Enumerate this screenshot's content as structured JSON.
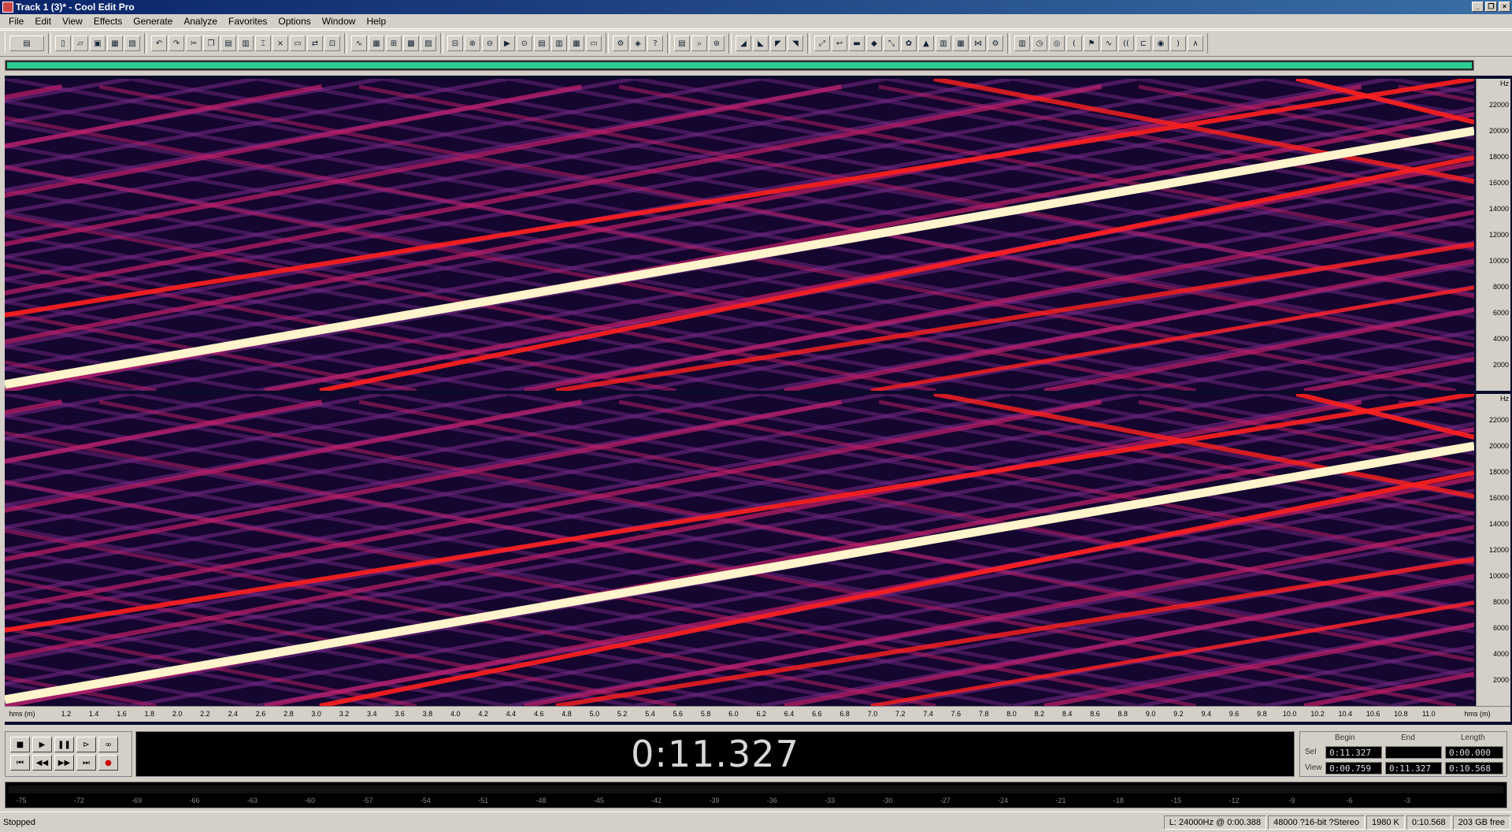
{
  "window": {
    "title": "Track 1 (3)* - Cool Edit Pro"
  },
  "menu": [
    "File",
    "Edit",
    "View",
    "Effects",
    "Generate",
    "Analyze",
    "Favorites",
    "Options",
    "Window",
    "Help"
  ],
  "spectral": {
    "freq_ticks": [
      "22000",
      "20000",
      "18000",
      "16000",
      "14000",
      "12000",
      "10000",
      "8000",
      "6000",
      "4000",
      "2000"
    ],
    "freq_unit": "Hz",
    "time_unit": "hms (m)",
    "time_ticks": [
      "1.2",
      "1.4",
      "1.6",
      "1.8",
      "2.0",
      "2.2",
      "2.4",
      "2.6",
      "2.8",
      "3.0",
      "3.2",
      "3.4",
      "3.6",
      "3.8",
      "4.0",
      "4.2",
      "4.4",
      "4.6",
      "4.8",
      "5.0",
      "5.2",
      "5.4",
      "5.6",
      "5.8",
      "6.0",
      "6.2",
      "6.4",
      "6.6",
      "6.8",
      "7.0",
      "7.2",
      "7.4",
      "7.6",
      "7.8",
      "8.0",
      "8.2",
      "8.4",
      "8.6",
      "8.8",
      "9.0",
      "9.2",
      "9.4",
      "9.6",
      "9.8",
      "10.0",
      "10.2",
      "10.4",
      "10.6",
      "10.8",
      "11.0"
    ],
    "colors": {
      "background": "#14062e",
      "lines_faint": "#7a2a8a",
      "lines_mid": "#c0206a",
      "lines_bright": "#ff2020",
      "main": "#fff4cc"
    }
  },
  "transport": {
    "time": "0:11.327"
  },
  "selection": {
    "headers": {
      "begin": "Begin",
      "end": "End",
      "length": "Length"
    },
    "sel_label": "Sel",
    "view_label": "View",
    "sel": {
      "begin": "0:11.327",
      "end": "",
      "length": "0:00.000"
    },
    "view": {
      "begin": "0:00.759",
      "end": "0:11.327",
      "length": "0:10.568"
    }
  },
  "level_ticks": [
    "-75",
    "-72",
    "-69",
    "-66",
    "-63",
    "-60",
    "-57",
    "-54",
    "-51",
    "-48",
    "-45",
    "-42",
    "-39",
    "-36",
    "-33",
    "-30",
    "-27",
    "-24",
    "-21",
    "-18",
    "-15",
    "-12",
    "-9",
    "-6",
    "-3"
  ],
  "status": {
    "text": "Stopped",
    "cells": [
      "L: 24000Hz @ 0:00.388",
      "48000 ?16-bit ?Stereo",
      "1980 K",
      "0:10.568",
      "203 GB free"
    ]
  }
}
